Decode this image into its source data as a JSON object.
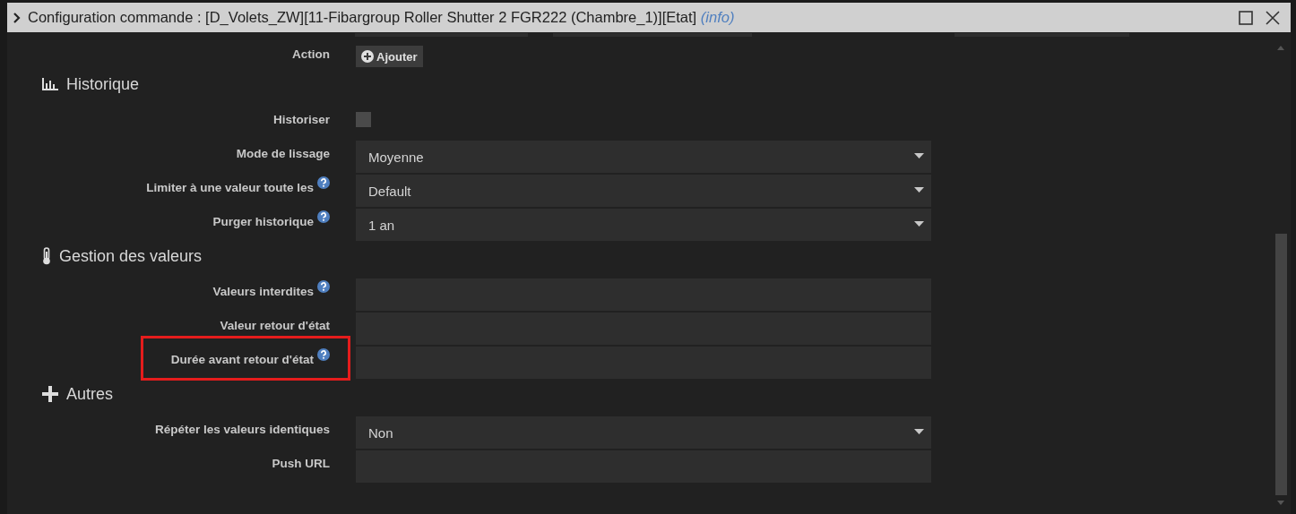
{
  "window": {
    "title": "Configuration commande : [D_Volets_ZW][11-Fibargroup Roller Shutter 2 FGR222 (Chambre_1)][Etat]",
    "info_link": "(info)"
  },
  "action": {
    "label": "Action",
    "button": "Ajouter"
  },
  "sections": [
    {
      "title": "Historique",
      "rows": [
        {
          "label": "Historiser",
          "kind": "checkbox",
          "checked": false,
          "help": false,
          "highlighted": false
        },
        {
          "label": "Mode de lissage",
          "kind": "select",
          "value": "Moyenne",
          "help": false,
          "highlighted": false
        },
        {
          "label": "Limiter à une valeur toute les",
          "kind": "select",
          "value": "Default",
          "help": true,
          "highlighted": false
        },
        {
          "label": "Purger historique",
          "kind": "select",
          "value": "1 an",
          "help": true,
          "highlighted": false
        }
      ]
    },
    {
      "title": "Gestion des valeurs",
      "rows": [
        {
          "label": "Valeurs interdites",
          "kind": "input",
          "help": true,
          "highlighted": false
        },
        {
          "label": "Valeur retour d'état",
          "kind": "input",
          "help": false,
          "highlighted": false
        },
        {
          "label": "Durée avant retour d'état",
          "kind": "input",
          "help": true,
          "highlighted": true
        }
      ]
    },
    {
      "title": "Autres",
      "rows": [
        {
          "label": "Répéter les valeurs identiques",
          "kind": "select",
          "value": "Non",
          "help": false,
          "highlighted": false
        },
        {
          "label": "Push URL",
          "kind": "input",
          "help": false,
          "highlighted": false
        }
      ]
    }
  ]
}
